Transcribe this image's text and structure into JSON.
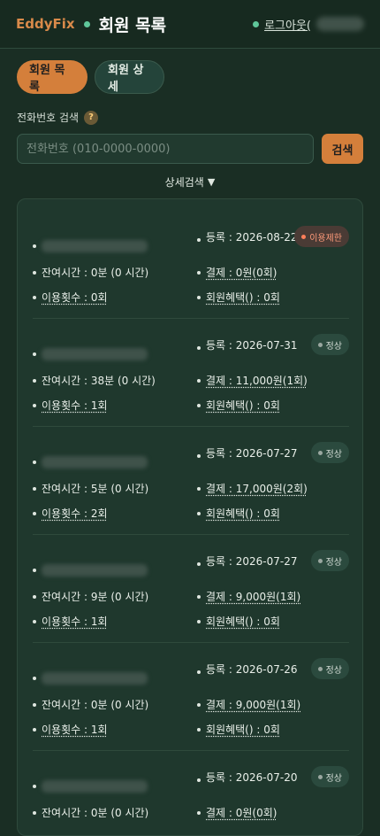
{
  "header": {
    "brand": "EddyFix",
    "title": "회원 목록",
    "logout_label": "로그아웃("
  },
  "tabs": [
    {
      "label": "회원 목록",
      "active": true
    },
    {
      "label": "회원 상세",
      "active": false
    }
  ],
  "search": {
    "label": "전화번호 검색",
    "help": "?",
    "placeholder": "전화번호 (010-0000-0000)",
    "value": "",
    "button": "검색"
  },
  "advanced_search": {
    "label": "상세검색",
    "caret": "▼"
  },
  "colors": {
    "accent": "#d47f3b",
    "background": "#1a2e24",
    "card": "#1f382d",
    "status_limit": "#ff7f5a"
  },
  "members": [
    {
      "reg": "등록 : 2026-08-22",
      "status": "이용제한",
      "status_type": "limit",
      "remaining": "잔여시간 : 0분 (0 시간)",
      "payment": "결제 : 0원(0회)",
      "usage": "이용횟수 : 0회",
      "benefit": "회원혜택() : 0회"
    },
    {
      "reg": "등록 : 2026-07-31",
      "status": "정상",
      "status_type": "normal",
      "remaining": "잔여시간 : 38분 (0 시간)",
      "payment": "결제 : 11,000원(1회)",
      "usage": "이용횟수 : 1회",
      "benefit": "회원혜택() : 0회"
    },
    {
      "reg": "등록 : 2026-07-27",
      "status": "정상",
      "status_type": "normal",
      "remaining": "잔여시간 : 5분 (0 시간)",
      "payment": "결제 : 17,000원(2회)",
      "usage": "이용횟수 : 2회",
      "benefit": "회원혜택() : 0회"
    },
    {
      "reg": "등록 : 2026-07-27",
      "status": "정상",
      "status_type": "normal",
      "remaining": "잔여시간 : 9분 (0 시간)",
      "payment": "결제 : 9,000원(1회)",
      "usage": "이용횟수 : 1회",
      "benefit": "회원혜택() : 0회"
    },
    {
      "reg": "등록 : 2026-07-26",
      "status": "정상",
      "status_type": "normal",
      "remaining": "잔여시간 : 0분 (0 시간)",
      "payment": "결제 : 9,000원(1회)",
      "usage": "이용횟수 : 1회",
      "benefit": "회원혜택() : 0회"
    },
    {
      "reg": "등록 : 2026-07-20",
      "status": "정상",
      "status_type": "normal",
      "remaining": "잔여시간 : 0분 (0 시간)",
      "payment": "결제 : 0원(0회)",
      "usage": "",
      "benefit": ""
    }
  ]
}
